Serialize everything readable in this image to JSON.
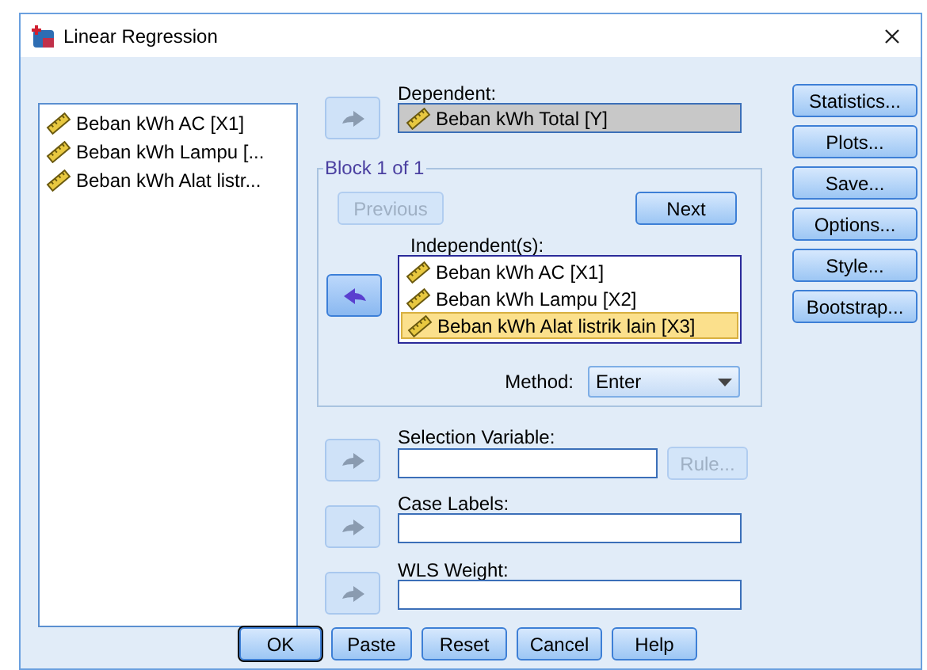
{
  "window": {
    "title": "Linear Regression"
  },
  "variables": [
    {
      "label": "Beban kWh AC [X1]"
    },
    {
      "label": "Beban kWh Lampu [..."
    },
    {
      "label": "Beban kWh Alat listr..."
    }
  ],
  "dependent": {
    "label": "Dependent:",
    "value": "Beban kWh Total [Y]",
    "arrow": {
      "kind": "add",
      "disabled": true
    }
  },
  "block": {
    "title": "Block 1 of 1",
    "previous": {
      "label": "Previous",
      "disabled": true
    },
    "next": {
      "label": "Next",
      "disabled": false
    },
    "independents_label": "Independent(s):",
    "arrow": {
      "kind": "remove",
      "disabled": false
    },
    "independents": [
      {
        "label": "Beban kWh AC [X1]",
        "selected": false
      },
      {
        "label": "Beban kWh Lampu [X2]",
        "selected": false
      },
      {
        "label": "Beban kWh Alat listrik lain [X3]",
        "selected": true
      }
    ],
    "method_label": "Method:",
    "method": "Enter"
  },
  "selection_variable": {
    "label": "Selection Variable:",
    "arrow": {
      "kind": "add",
      "disabled": true
    },
    "rule": {
      "label": "Rule...",
      "disabled": true
    }
  },
  "case_labels": {
    "label": "Case Labels:",
    "arrow": {
      "kind": "add",
      "disabled": true
    }
  },
  "wls_weight": {
    "label": "WLS Weight:",
    "arrow": {
      "kind": "add",
      "disabled": true
    }
  },
  "side_buttons": [
    "Statistics...",
    "Plots...",
    "Save...",
    "Options...",
    "Style...",
    "Bootstrap..."
  ],
  "buttons": [
    {
      "label": "OK",
      "default": true
    },
    {
      "label": "Paste",
      "default": false
    },
    {
      "label": "Reset",
      "default": false
    },
    {
      "label": "Cancel",
      "default": false
    },
    {
      "label": "Help",
      "default": false
    }
  ]
}
